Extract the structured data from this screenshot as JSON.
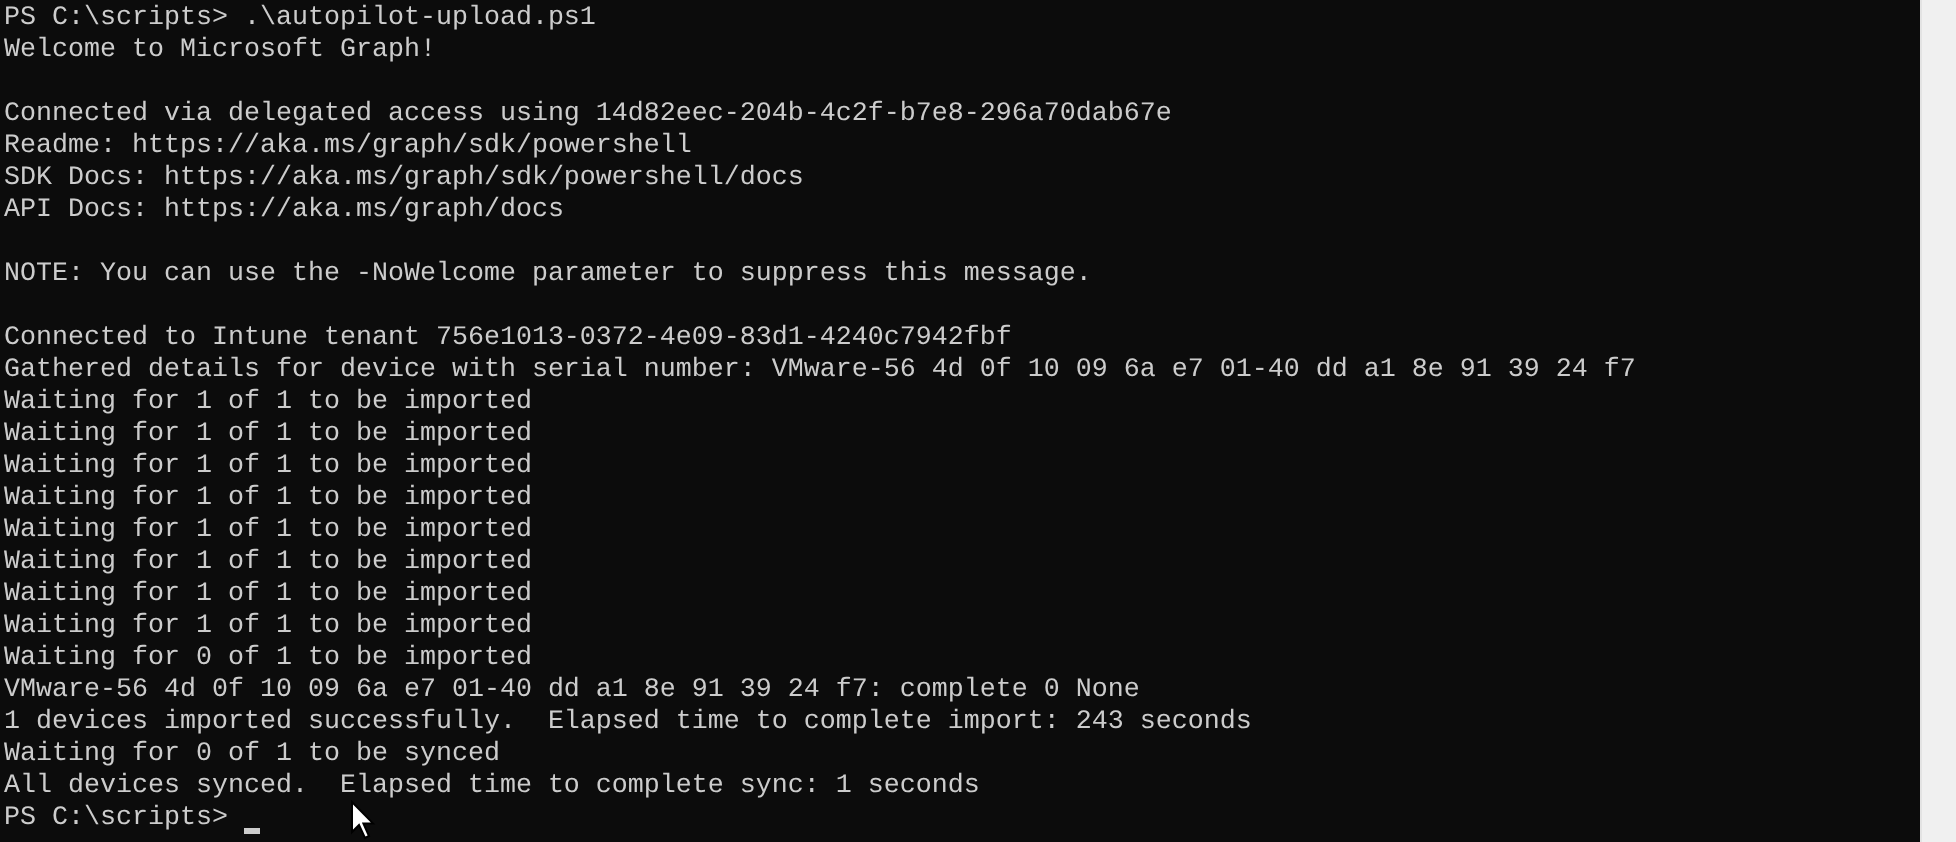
{
  "console": {
    "blocks": [
      [
        "PS C:\\scripts> .\\autopilot-upload.ps1",
        "Welcome to Microsoft Graph!"
      ],
      [
        "Connected via delegated access using 14d82eec-204b-4c2f-b7e8-296a70dab67e",
        "Readme: https://aka.ms/graph/sdk/powershell",
        "SDK Docs: https://aka.ms/graph/sdk/powershell/docs",
        "API Docs: https://aka.ms/graph/docs"
      ],
      [
        "NOTE: You can use the -NoWelcome parameter to suppress this message."
      ],
      [
        "Connected to Intune tenant 756e1013-0372-4e09-83d1-4240c7942fbf",
        "Gathered details for device with serial number: VMware-56 4d 0f 10 09 6a e7 01-40 dd a1 8e 91 39 24 f7",
        "Waiting for 1 of 1 to be imported",
        "Waiting for 1 of 1 to be imported",
        "Waiting for 1 of 1 to be imported",
        "Waiting for 1 of 1 to be imported",
        "Waiting for 1 of 1 to be imported",
        "Waiting for 1 of 1 to be imported",
        "Waiting for 1 of 1 to be imported",
        "Waiting for 1 of 1 to be imported",
        "Waiting for 0 of 1 to be imported",
        "VMware-56 4d 0f 10 09 6a e7 01-40 dd a1 8e 91 39 24 f7: complete 0 None",
        "1 devices imported successfully.  Elapsed time to complete import: 243 seconds",
        "Waiting for 0 of 1 to be synced",
        "All devices synced.  Elapsed time to complete sync: 1 seconds"
      ]
    ],
    "prompt": {
      "text": "PS C:\\scripts>",
      "cursor": true
    }
  }
}
